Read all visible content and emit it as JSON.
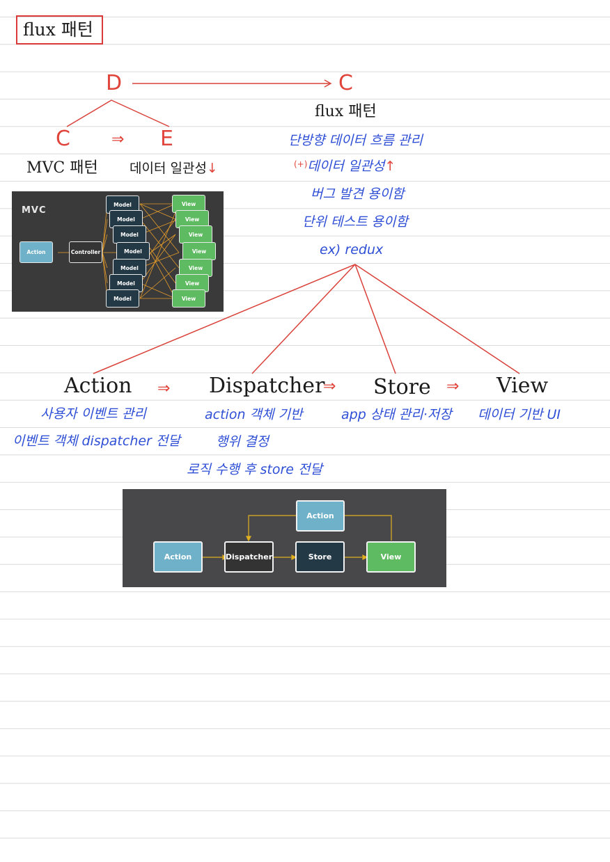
{
  "title": "flux 패턴",
  "top": {
    "d": "D",
    "c_right": "C",
    "c_left": "C",
    "e": "E",
    "arrow_small": "⇒",
    "mvc_label": "MVC 패턴",
    "consistency_down": "데이터 일관성",
    "down_arrow": "↓"
  },
  "flux_notes": {
    "title": "flux 패턴",
    "line1": "단방향 데이터 흐름 관리",
    "plus": "(+)",
    "line2": "데이터 일관성",
    "up_arrow": "↑",
    "line3": "버그 발견 용이함",
    "line4": "단위 테스트 용이함",
    "line5": "ex) redux"
  },
  "mvc_diagram": {
    "title": "MVC",
    "action": "Action",
    "controller": "Controller",
    "model": "Model",
    "view": "View"
  },
  "parts": {
    "action": {
      "name": "Action",
      "desc1": "사용자 이벤트 관리",
      "desc2": "이벤트 객체 dispatcher 전달"
    },
    "dispatcher": {
      "name": "Dispatcher",
      "desc1": "action 객체 기반",
      "desc2": "행위 결정",
      "desc3": "로직 수행 후 store 전달"
    },
    "store": {
      "name": "Store",
      "desc1": "app 상태 관리·저장"
    },
    "view": {
      "name": "View",
      "desc1": "데이터 기반 UI"
    },
    "arrow": "⇒"
  },
  "flux_diagram": {
    "action_top": "Action",
    "action": "Action",
    "dispatcher": "Dispatcher",
    "store": "Store",
    "view": "View"
  },
  "colors": {
    "ink_red": "#e0443a",
    "ink_blue": "#2f4fd6",
    "action": "#6fb1c9",
    "store": "#243946",
    "view": "#5fbb61",
    "arrow_yellow": "#e0b020"
  }
}
